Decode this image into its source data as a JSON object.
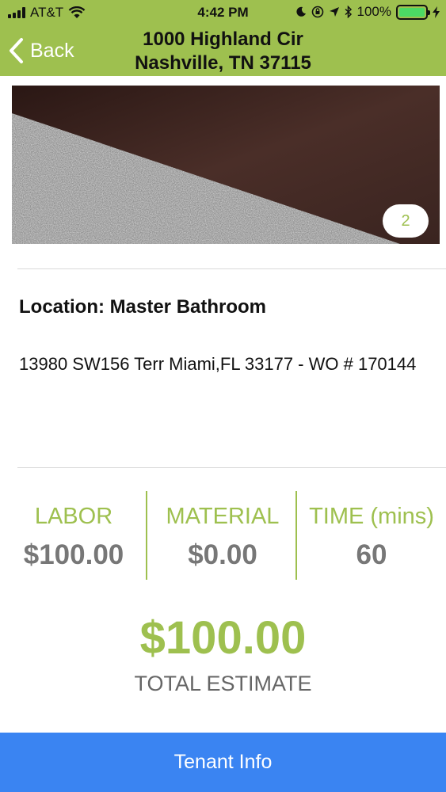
{
  "status_bar": {
    "carrier": "AT&T",
    "time": "4:42 PM",
    "battery": "100%"
  },
  "nav": {
    "back_label": "Back",
    "title_line1": "1000 Highland Cir",
    "title_line2": "Nashville, TN 37115"
  },
  "photo": {
    "count": "2"
  },
  "details": {
    "location": "Location: Master Bathroom",
    "address": "13980 SW156 Terr Miami,FL 33177 - WO # 170144"
  },
  "estimate": {
    "labor_label": "LABOR",
    "labor_value": "$100.00",
    "material_label": "MATERIAL",
    "material_value": "$0.00",
    "time_label": "TIME (mins)",
    "time_value": "60",
    "total_value": "$100.00",
    "total_label": "TOTAL ESTIMATE"
  },
  "footer": {
    "button_label": "Tenant Info"
  },
  "colors": {
    "accent": "#9ec04f",
    "button": "#3a84f2"
  }
}
